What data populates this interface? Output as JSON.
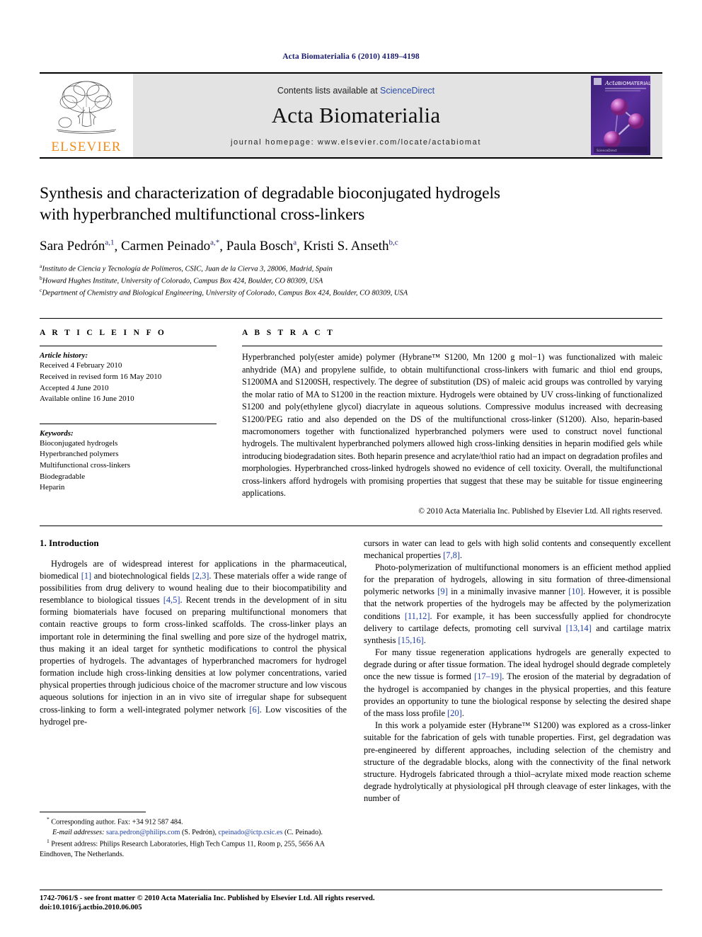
{
  "running_head": "Acta Biomaterialia 6 (2010) 4189–4198",
  "masthead": {
    "publisher": "ELSEVIER",
    "contents_prefix": "Contents lists available at ",
    "sciencedirect": "ScienceDirect",
    "journal_name": "Acta Biomaterialia",
    "homepage": "journal homepage: www.elsevier.com/locate/actabiomat",
    "cover_title_italic": "Acta",
    "cover_title_rest": "BIOMATERIALIA"
  },
  "article": {
    "title_line1": "Synthesis and characterization of degradable bioconjugated hydrogels",
    "title_line2": "with hyperbranched multifunctional cross-linkers",
    "authors": [
      {
        "name": "Sara Pedrón",
        "marks": "a,1"
      },
      {
        "name": "Carmen Peinado",
        "marks": "a,*"
      },
      {
        "name": "Paula Bosch",
        "marks": "a"
      },
      {
        "name": "Kristi S. Anseth",
        "marks": "b,c"
      }
    ],
    "affiliations": [
      {
        "mark": "a",
        "text": "Instituto de Ciencia y Tecnología de Polímeros, CSIC, Juan de la Cierva 3, 28006, Madrid, Spain"
      },
      {
        "mark": "b",
        "text": "Howard Hughes Institute, University of Colorado, Campus Box 424, Boulder, CO 80309, USA"
      },
      {
        "mark": "c",
        "text": "Department of Chemistry and Biological Engineering, University of Colorado, Campus Box 424, Boulder, CO 80309, USA"
      }
    ]
  },
  "article_info": {
    "heading": "A R T I C L E   I N F O",
    "history_label": "Article history:",
    "history": [
      "Received 4 February 2010",
      "Received in revised form 16 May 2010",
      "Accepted 4 June 2010",
      "Available online 16 June 2010"
    ],
    "keywords_label": "Keywords:",
    "keywords": [
      "Bioconjugated hydrogels",
      "Hyperbranched polymers",
      "Multifunctional cross-linkers",
      "Biodegradable",
      "Heparin"
    ]
  },
  "abstract": {
    "heading": "A B S T R A C T",
    "text": "Hyperbranched poly(ester amide) polymer (Hybrane™ S1200, Mn 1200 g mol−1) was functionalized with maleic anhydride (MA) and propylene sulfide, to obtain multifunctional cross-linkers with fumaric and thiol end groups, S1200MA and S1200SH, respectively. The degree of substitution (DS) of maleic acid groups was controlled by varying the molar ratio of MA to S1200 in the reaction mixture. Hydrogels were obtained by UV cross-linking of functionalized S1200 and poly(ethylene glycol) diacrylate in aqueous solutions. Compressive modulus increased with decreasing S1200/PEG ratio and also depended on the DS of the multifunctional cross-linker (S1200). Also, heparin-based macromonomers together with functionalized hyperbranched polymers were used to construct novel functional hydrogels. The multivalent hyperbranched polymers allowed high cross-linking densities in heparin modified gels while introducing biodegradation sites. Both heparin presence and acrylate/thiol ratio had an impact on degradation profiles and morphologies. Hyperbranched cross-linked hydrogels showed no evidence of cell toxicity. Overall, the multifunctional cross-linkers afford hydrogels with promising properties that suggest that these may be suitable for tissue engineering applications.",
    "copyright": "© 2010 Acta Materialia Inc. Published by Elsevier Ltd. All rights reserved."
  },
  "introduction": {
    "heading": "1. Introduction",
    "left_paragraphs": [
      "Hydrogels are of widespread interest for applications in the pharmaceutical, biomedical [1] and biotechnological fields [2,3]. These materials offer a wide range of possibilities from drug delivery to wound healing due to their biocompatibility and resemblance to biological tissues [4,5]. Recent trends in the development of in situ forming biomaterials have focused on preparing multifunctional monomers that contain reactive groups to form cross-linked scaffolds. The cross-linker plays an important role in determining the final swelling and pore size of the hydrogel matrix, thus making it an ideal target for synthetic modifications to control the physical properties of hydrogels. The advantages of hyperbranched macromers for hydrogel formation include high cross-linking densities at low polymer concentrations, varied physical properties through judicious choice of the macromer structure and low viscous aqueous solutions for injection in an in vivo site of irregular shape for subsequent cross-linking to form a well-integrated polymer network [6]. Low viscosities of the hydrogel pre-"
    ],
    "right_paragraphs": [
      "cursors in water can lead to gels with high solid contents and consequently excellent mechanical properties [7,8].",
      "Photo-polymerization of multifunctional monomers is an efficient method applied for the preparation of hydrogels, allowing in situ formation of three-dimensional polymeric networks [9] in a minimally invasive manner [10]. However, it is possible that the network properties of the hydrogels may be affected by the polymerization conditions [11,12]. For example, it has been successfully applied for chondrocyte delivery to cartilage defects, promoting cell survival [13,14] and cartilage matrix synthesis [15,16].",
      "For many tissue regeneration applications hydrogels are generally expected to degrade during or after tissue formation. The ideal hydrogel should degrade completely once the new tissue is formed [17–19]. The erosion of the material by degradation of the hydrogel is accompanied by changes in the physical properties, and this feature provides an opportunity to tune the biological response by selecting the desired shape of the mass loss profile [20].",
      "In this work a polyamide ester (Hybrane™ S1200) was explored as a cross-linker suitable for the fabrication of gels with tunable properties. First, gel degradation was pre-engineered by different approaches, including selection of the chemistry and structure of the degradable blocks, along with the connectivity of the final network structure. Hydrogels fabricated through a thiol–acrylate mixed mode reaction scheme degrade hydrolytically at physiological pH through cleavage of ester linkages, with the number of"
    ]
  },
  "footnotes": {
    "corresponding": "Corresponding author. Fax: +34 912 587 484.",
    "email_label": "E-mail addresses:",
    "email1": "sara.pedron@philips.com",
    "email1_owner": " (S. Pedrón), ",
    "email2": "cpeinado@ictp.csic.es",
    "email2_owner": " (C. Peinado).",
    "present_address_mark": "1",
    "present_address": "Present address: Philips Research Laboratories, High Tech Campus 11, Room p, 255, 5656 AA Eindhoven, The Netherlands."
  },
  "page_footer": {
    "issn_line": "1742-7061/$ - see front matter © 2010 Acta Materialia Inc. Published by Elsevier Ltd. All rights reserved.",
    "doi": "doi:10.1016/j.actbio.2010.06.005"
  },
  "colors": {
    "elsevier_orange": "#F08D1C",
    "link_blue": "#1d3fa8",
    "running_head_navy": "#1a1a6e",
    "masthead_grey": "#e3e3e3",
    "cover_purple": "#4b2a8c",
    "cover_sphere": "#c05bbf"
  }
}
